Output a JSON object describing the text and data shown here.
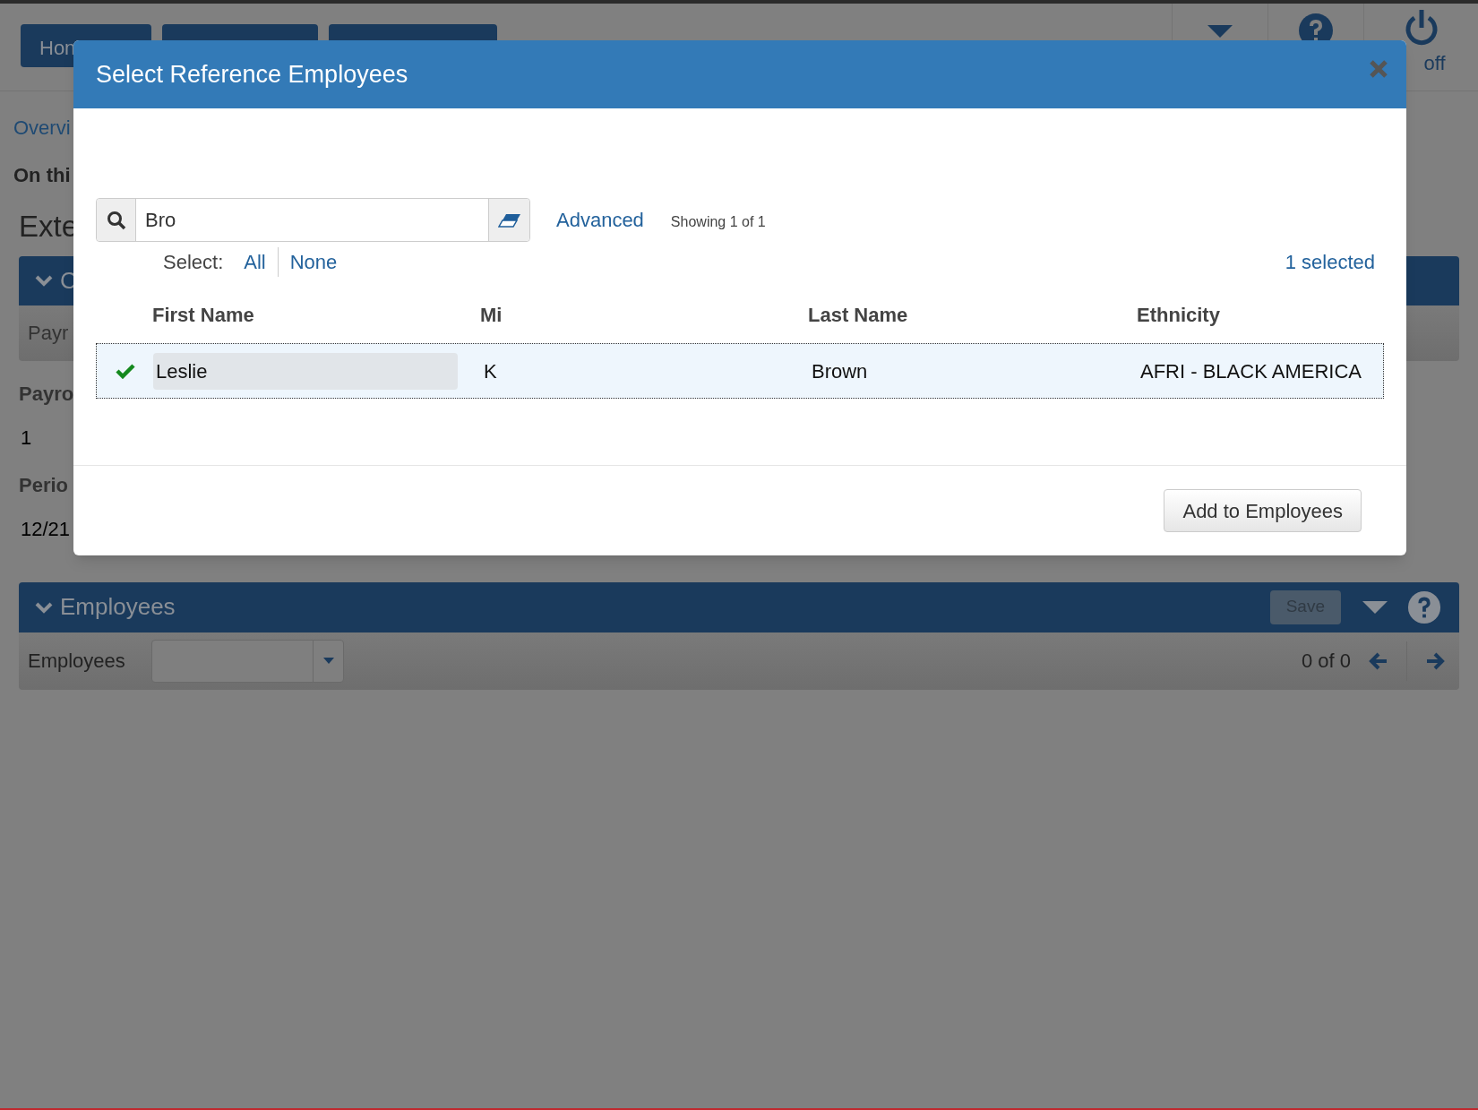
{
  "background": {
    "nav_tabs": [
      {
        "label": "Hon"
      }
    ],
    "user_label": "off",
    "breadcrumb": "Overvi",
    "intro": "On thi",
    "page_title": "Exte",
    "section": {
      "title": "C",
      "field_label": "Payr",
      "expanded": true
    },
    "fields": [
      {
        "label": "Payro",
        "value": "1"
      },
      {
        "label": "Perio",
        "value": "12/21"
      }
    ],
    "employees_panel": {
      "title": "Employees",
      "expanded": true,
      "save": "Save",
      "save_disabled": true,
      "field_label": "Employees",
      "pager": "0 of 0"
    }
  },
  "dialog": {
    "title": "Select Reference Employees",
    "search": {
      "value": "Bro"
    },
    "advanced": "Advanced",
    "showing": "Showing 1 of 1",
    "select_label": "Select:",
    "select_links": [
      "All",
      "None"
    ],
    "selected_count": "1 selected",
    "columns": [
      "First Name",
      "Mi",
      "Last Name",
      "Ethnicity"
    ],
    "rows": [
      {
        "selected": true,
        "cells": [
          "Leslie",
          "K",
          "Brown",
          "AFRI - BLACK AMERICA"
        ]
      }
    ],
    "footer_button": "Add to Employees"
  }
}
